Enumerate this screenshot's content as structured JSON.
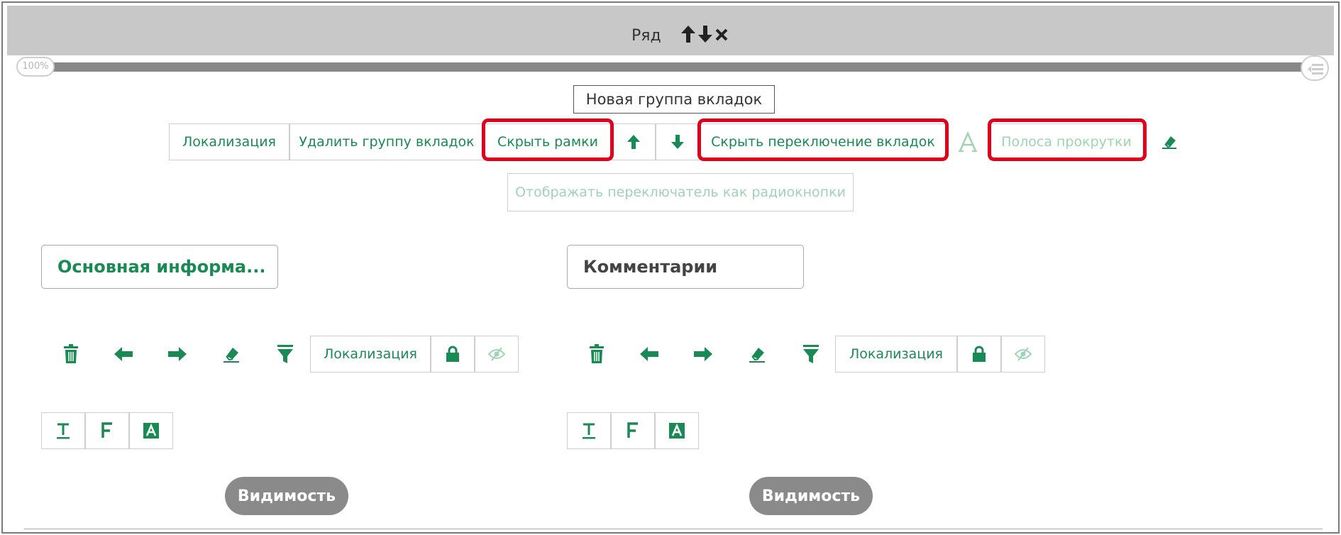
{
  "header": {
    "title": "Ряд"
  },
  "progress": {
    "percent_label": "100%",
    "value": 100
  },
  "tab_group": {
    "name": "Новая группа вкладок"
  },
  "toolbar": {
    "localization": "Локализация",
    "delete_group": "Удалить группу вкладок",
    "hide_borders": "Скрыть рамки",
    "hide_tab_switch": "Скрыть переключение вкладок",
    "scrollbar": "Полоса прокрутки",
    "radio_switch": "Отображать переключатель как радиокнопки"
  },
  "tabs": [
    {
      "title": "Основная информа...",
      "localization": "Локализация",
      "visibility": "Видимость"
    },
    {
      "title": "Комментарии",
      "localization": "Локализация",
      "visibility": "Видимость"
    }
  ],
  "colors": {
    "accent_green": "#1a8a55",
    "faded_green": "#9fd3b6",
    "highlight_red": "#e0001b",
    "header_gray": "#c8c8c8"
  }
}
